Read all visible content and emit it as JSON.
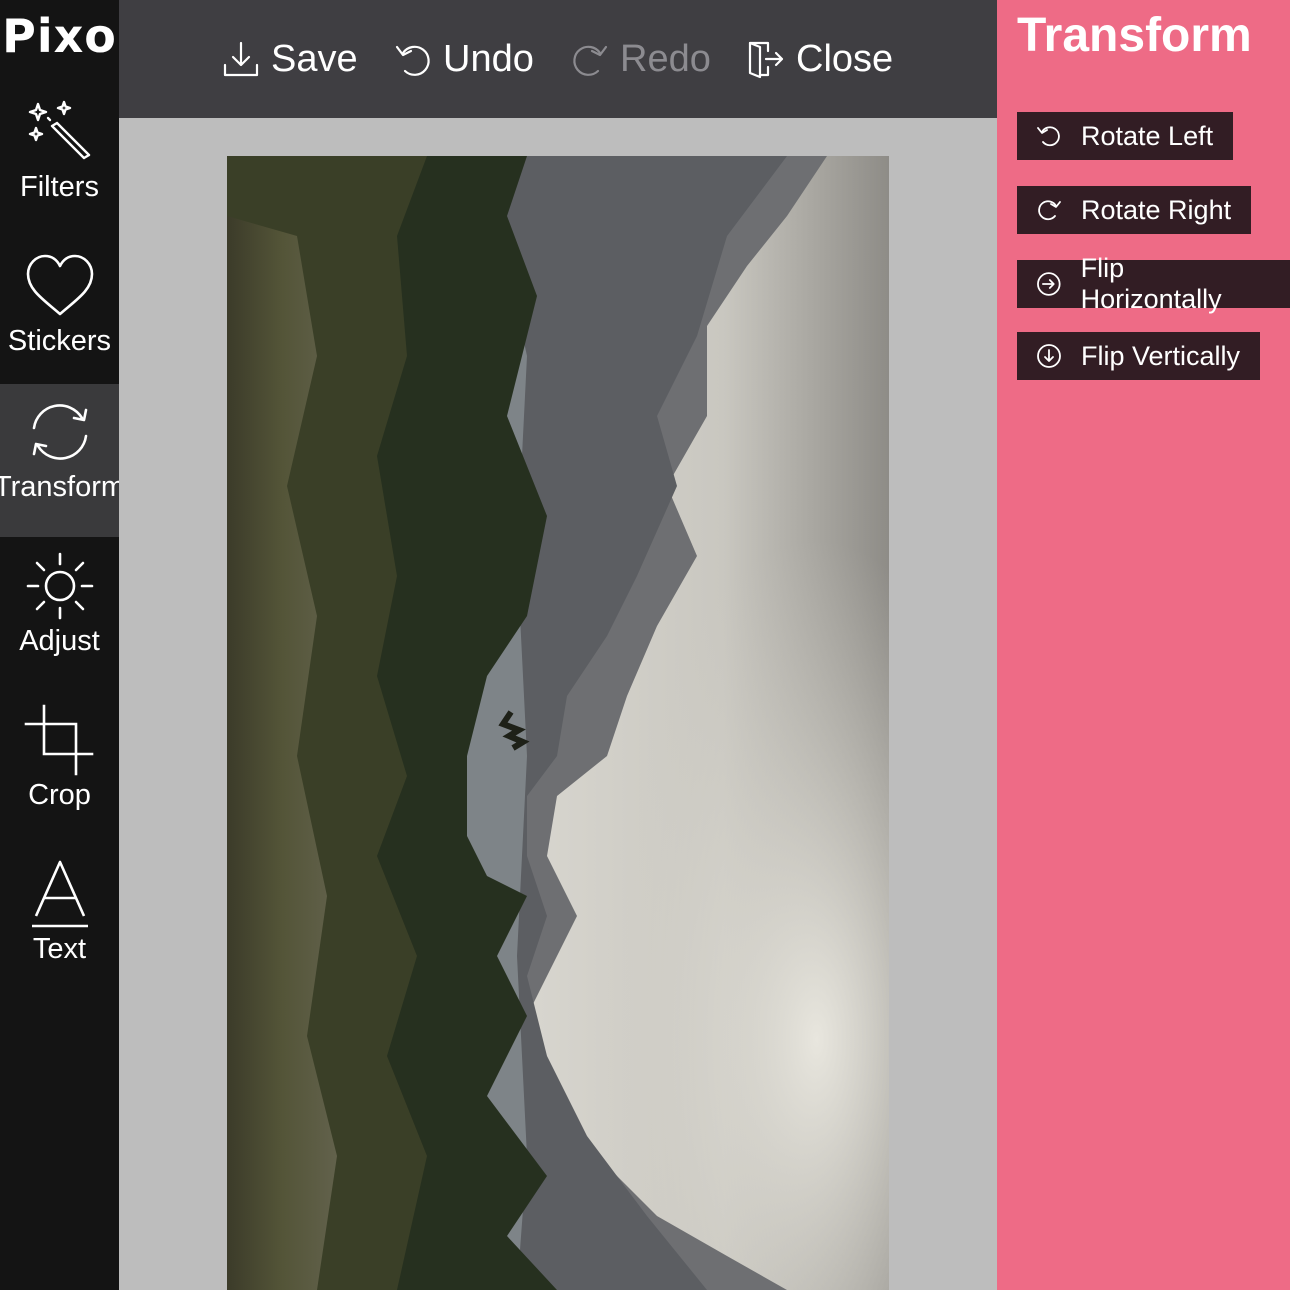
{
  "app": {
    "logo_text": "Pixo"
  },
  "toolbar": {
    "save": "Save",
    "undo": "Undo",
    "redo": "Redo",
    "close": "Close"
  },
  "sidebar": {
    "items": [
      {
        "label": "Filters",
        "icon": "magic-wand-icon"
      },
      {
        "label": "Stickers",
        "icon": "heart-icon"
      },
      {
        "label": "Transform",
        "icon": "rotate-icon",
        "active": true
      },
      {
        "label": "Adjust",
        "icon": "sun-icon"
      },
      {
        "label": "Crop",
        "icon": "crop-icon"
      },
      {
        "label": "Text",
        "icon": "text-icon"
      }
    ]
  },
  "panel": {
    "title": "Transform",
    "buttons": [
      {
        "label": "Rotate Left",
        "icon": "rotate-left-icon"
      },
      {
        "label": "Rotate Right",
        "icon": "rotate-right-icon"
      },
      {
        "label": "Flip Horizontally",
        "icon": "arrow-right-circle-icon"
      },
      {
        "label": "Flip Vertically",
        "icon": "arrow-down-circle-icon"
      }
    ]
  },
  "colors": {
    "sidebar_bg": "#141414",
    "active_item_bg": "#3a3a3c",
    "toolbar_bg": "#3f3e42",
    "panel_bg": "#ee6b86",
    "panel_button_bg": "#321d24",
    "canvas_bg": "#bdbdbd",
    "disabled_text": "#8c8b90"
  }
}
